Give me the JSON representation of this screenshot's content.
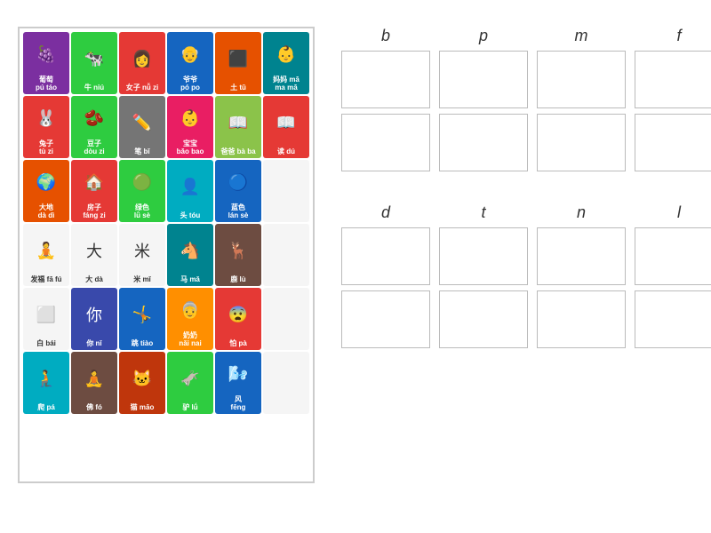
{
  "cards": [
    {
      "emoji": "🍇",
      "label": "葡萄\npú táo",
      "color": "purple"
    },
    {
      "emoji": "🐄",
      "label": "牛 niú",
      "color": "green"
    },
    {
      "emoji": "👩",
      "label": "女子 nǚ zi",
      "color": "red"
    },
    {
      "emoji": "👴",
      "label": "爷爷\npó po",
      "color": "blue"
    },
    {
      "emoji": "⬛",
      "label": "土 tǔ",
      "color": "orange"
    },
    {
      "emoji": "👶",
      "label": "妈妈 mā\nma mā",
      "color": "teal"
    },
    {
      "emoji": "🐰",
      "label": "兔子\ntù zi",
      "color": "red"
    },
    {
      "emoji": "🫘",
      "label": "豆子\ndòu zi",
      "color": "green"
    },
    {
      "emoji": "✏️",
      "label": "笔 bǐ",
      "color": "grey"
    },
    {
      "emoji": "👶",
      "label": "宝宝\nbǎo bao",
      "color": "pink"
    },
    {
      "emoji": "📖",
      "label": "爸爸 bà ba",
      "color": "lime"
    },
    {
      "emoji": "📖",
      "label": "读 dú",
      "color": "red"
    },
    {
      "emoji": "🌍",
      "label": "大地\ndà dì",
      "color": "orange"
    },
    {
      "emoji": "🏠",
      "label": "房子\nfáng zi",
      "color": "red"
    },
    {
      "emoji": "🟢",
      "label": "绿色\nlǜ sè",
      "color": "green"
    },
    {
      "emoji": "👤",
      "label": "头 tóu",
      "color": "cyan"
    },
    {
      "emoji": "🔵",
      "label": "蓝色\nlán sè",
      "color": "blue"
    },
    {
      "emoji": "",
      "label": "",
      "color": "white-card"
    },
    {
      "emoji": "🧘",
      "label": "发福 fā fú",
      "color": "white-card"
    },
    {
      "emoji": "大",
      "label": "大 dà",
      "color": "white-card"
    },
    {
      "emoji": "米",
      "label": "米 mǐ",
      "color": "white-card"
    },
    {
      "emoji": "🐴",
      "label": "马 mǎ",
      "color": "teal"
    },
    {
      "emoji": "🦌",
      "label": "鹿 lù",
      "color": "brown"
    },
    {
      "emoji": "",
      "label": "",
      "color": "white-card"
    },
    {
      "emoji": "⬜",
      "label": "白 bái",
      "color": "white-card"
    },
    {
      "emoji": "你",
      "label": "你 nǐ",
      "color": "indigo"
    },
    {
      "emoji": "🤸",
      "label": "跳 tiào",
      "color": "blue"
    },
    {
      "emoji": "👵",
      "label": "奶奶\nnǎi nai",
      "color": "amber"
    },
    {
      "emoji": "😨",
      "label": "怕 pà",
      "color": "red"
    },
    {
      "emoji": "",
      "label": "",
      "color": "white-card"
    },
    {
      "emoji": "🧎",
      "label": "爬 pá",
      "color": "cyan"
    },
    {
      "emoji": "🧘",
      "label": "佛 fó",
      "color": "brown"
    },
    {
      "emoji": "🐱",
      "label": "猫 māo",
      "color": "deep-orange"
    },
    {
      "emoji": "🫏",
      "label": "驴 lǘ",
      "color": "green"
    },
    {
      "emoji": "🌬️",
      "label": "风\nfēng",
      "color": "blue"
    },
    {
      "emoji": "",
      "label": "",
      "color": "white-card"
    }
  ],
  "consonants_top": [
    "b",
    "p",
    "m",
    "f"
  ],
  "consonants_bottom": [
    "d",
    "t",
    "n",
    "l"
  ],
  "drop_rows": 2,
  "drop_cols": 4
}
